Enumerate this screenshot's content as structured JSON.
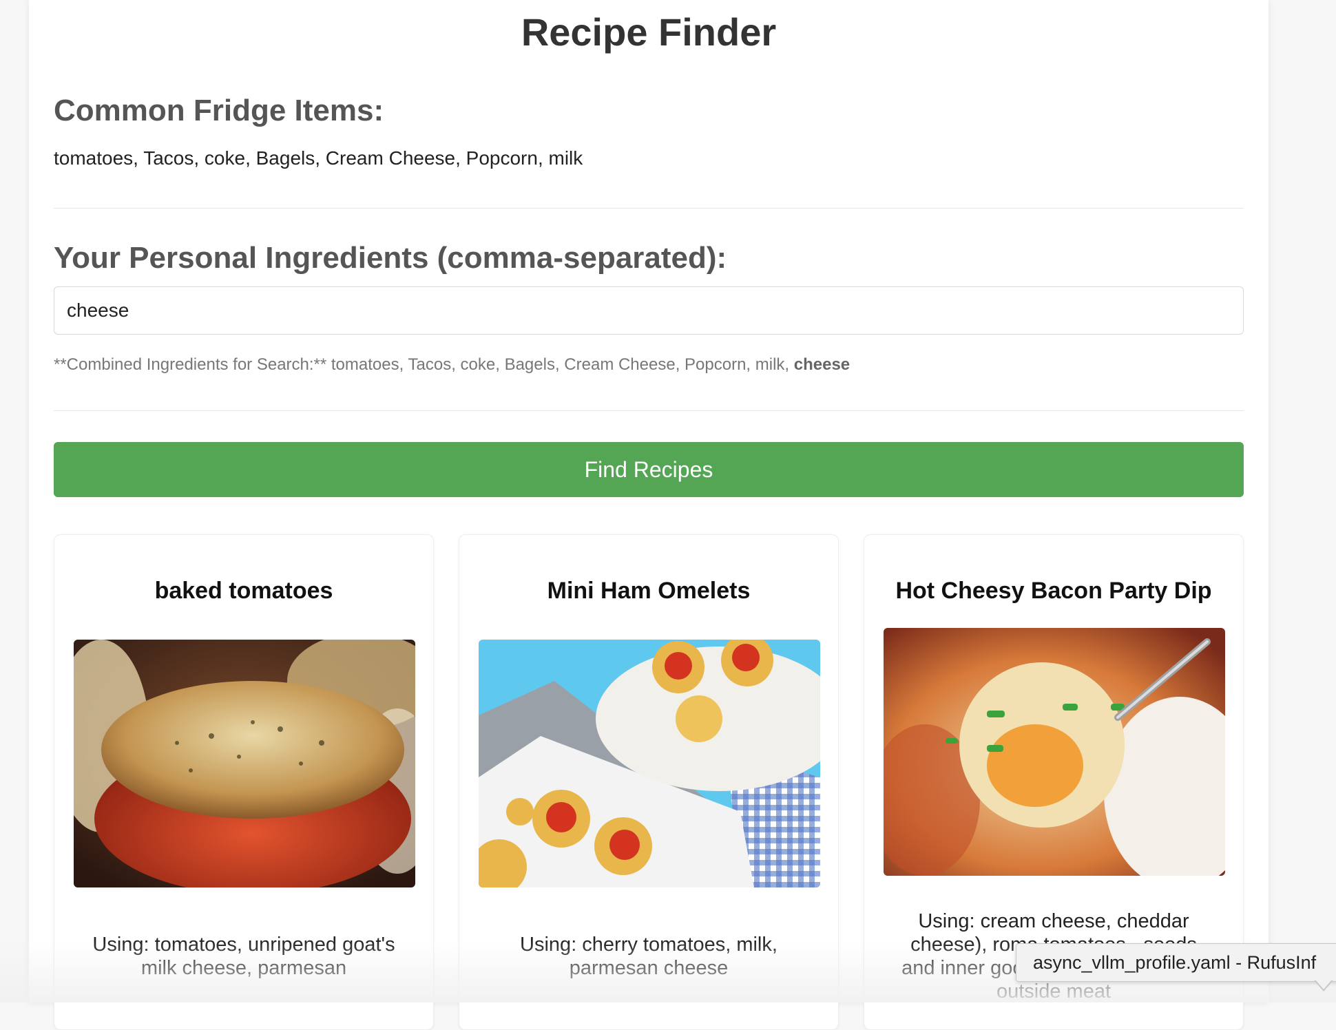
{
  "page": {
    "title": "Recipe Finder"
  },
  "fridge": {
    "heading": "Common Fridge Items:",
    "items_text": "tomatoes, Tacos, coke, Bagels, Cream Cheese, Popcorn, milk"
  },
  "personal": {
    "heading": "Your Personal Ingredients (comma-separated):",
    "input_value": "cheese"
  },
  "combined": {
    "prefix": "**Combined Ingredients for Search:** tomatoes, Tacos, coke, Bagels, Cream Cheese, Popcorn, milk, ",
    "added": "cheese"
  },
  "actions": {
    "find_label": "Find Recipes",
    "button_color": "#54a655"
  },
  "recipes": [
    {
      "title": "baked tomatoes",
      "using": "Using: tomatoes, unripened goat's milk cheese, parmesan"
    },
    {
      "title": "Mini Ham Omelets",
      "using": "Using: cherry tomatoes, milk, parmesan cheese"
    },
    {
      "title": "Hot Cheesy Bacon Party Dip",
      "using": "Using: cream cheese, cheddar cheese), roma tomatoes - seeds and inner goop removed, chopped outside meat"
    }
  ],
  "tooltip": {
    "text": "async_vllm_profile.yaml - RufusInf"
  }
}
